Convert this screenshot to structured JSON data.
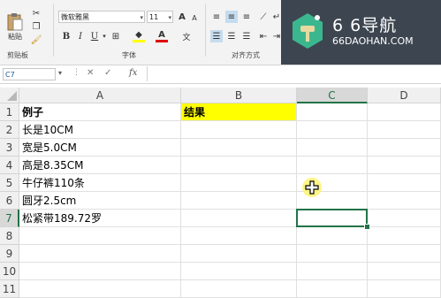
{
  "ribbon": {
    "clipboard": {
      "paste_label": "粘贴",
      "group_label": "剪贴板"
    },
    "font": {
      "font_name": "微软雅黑",
      "font_size": "11",
      "group_label": "字体",
      "bold": "B",
      "italic": "I",
      "underline": "U",
      "grow": "A",
      "shrink": "A"
    },
    "alignment": {
      "group_label": "对齐方式"
    }
  },
  "watermark": {
    "brand": "6 6导航",
    "url": "66DAOHAN.COM"
  },
  "formula_bar": {
    "name_box": "C7",
    "fx": "fx",
    "formula": ""
  },
  "grid": {
    "columns": [
      "A",
      "B",
      "C",
      "D"
    ],
    "rows": [
      "1",
      "2",
      "3",
      "4",
      "5",
      "6",
      "7",
      "8",
      "9",
      "10",
      "11"
    ],
    "cells": {
      "A1": "例子",
      "B1": "结果",
      "A2": "长是10CM",
      "A3": "宽是5.0CM",
      "A4": "高是8.35CM",
      "A5": "牛仔裤110条",
      "A6": "圆牙2.5cm",
      "A7": "松紧带189.72罗"
    },
    "selected_cell": "C7",
    "highlight_color": "#ffff00",
    "selection_color": "#217346"
  }
}
